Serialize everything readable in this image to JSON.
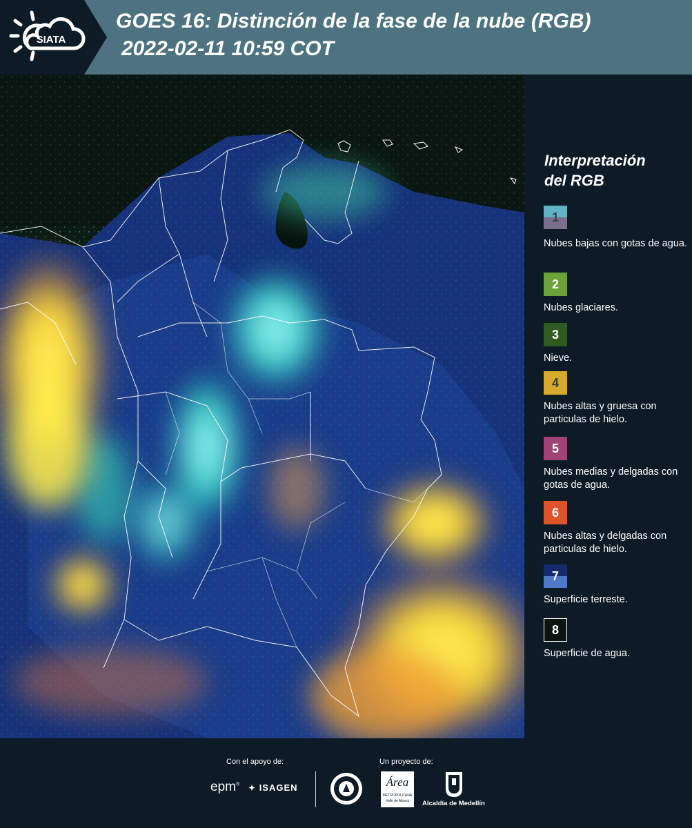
{
  "header": {
    "logo_text": "SIATA",
    "title_line1": "GOES 16: Distinción de la fase de la nube (RGB)",
    "title_line2": "2022-02-11 10:59 COT"
  },
  "legend": {
    "title_line1": "Interpretación",
    "title_line2": "del RGB",
    "items": [
      {
        "number": "1",
        "label": "Nubes bajas con gotas de agua.",
        "color_top": "#5fb3c4",
        "color_bottom": "#7a6f8c"
      },
      {
        "number": "2",
        "label": "Nubes glaciares.",
        "color": "#6aa338"
      },
      {
        "number": "3",
        "label": "Nieve.",
        "color": "#2f5a22"
      },
      {
        "number": "4",
        "label": "Nubes altas y gruesa con particulas de hielo.",
        "color": "#d6a92a"
      },
      {
        "number": "5",
        "label": "Nubes medias y delgadas con gotas de agua.",
        "color": "#a04478"
      },
      {
        "number": "6",
        "label": "Nubes altas y delgadas con particulas de hielo.",
        "color": "#e0532a"
      },
      {
        "number": "7",
        "label": "Superficie terreste.",
        "color_top": "#152a6a",
        "color_bottom": "#4f78c8"
      },
      {
        "number": "8",
        "label": "Superficie de agua.",
        "color": "#0a1410"
      }
    ]
  },
  "footer": {
    "support_label": "Con el apoyo de:",
    "project_label": "Un proyecto de:",
    "sponsor_epm": "epm",
    "sponsor_isagen": "ISAGEN",
    "area_metropolitana": "Área",
    "area_subtitle": "METROPOLITANA",
    "area_subtitle2": "Valle de Aburrá",
    "alcaldia": "Alcaldía de Medellín"
  }
}
